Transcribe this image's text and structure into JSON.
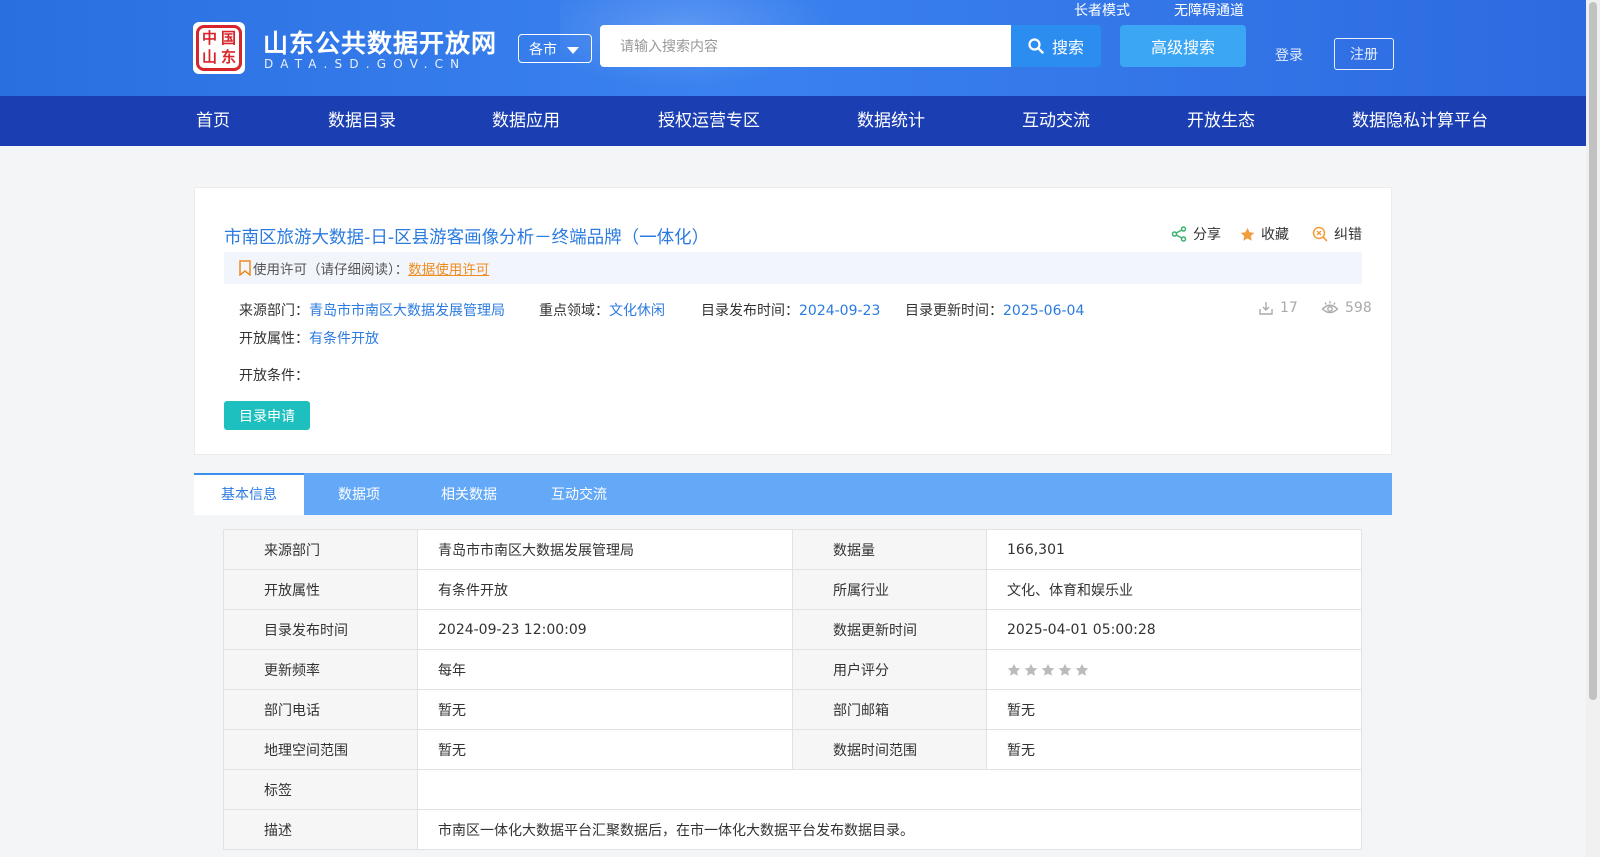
{
  "header": {
    "site_title": "山东公共数据开放网",
    "site_subtitle": "DATA.SD.GOV.CN",
    "logo_chars": [
      "中",
      "国",
      "山",
      "东"
    ],
    "city_select": "各市",
    "search_placeholder": "请输入搜索内容",
    "search_label": "搜索",
    "advanced_search_label": "高级搜索",
    "elder_mode": "长者模式",
    "accessibility": "无障碍通道",
    "login": "登录",
    "register": "注册"
  },
  "nav": {
    "items": [
      "首页",
      "数据目录",
      "数据应用",
      "授权运营专区",
      "数据统计",
      "互动交流",
      "开放生态",
      "数据隐私计算平台"
    ]
  },
  "detail": {
    "title": "市南区旅游大数据-日-区县游客画像分析－终端品牌（一体化）",
    "actions": {
      "share": "分享",
      "favorite": "收藏",
      "report": "纠错"
    },
    "license_prefix": "使用许可（请仔细阅读）：",
    "license_link": "数据使用许可",
    "source_label": "来源部门：",
    "source_value": "青岛市市南区大数据发展管理局",
    "domain_label": "重点领域：",
    "domain_value": "文化休闲",
    "publish_label": "目录发布时间：",
    "publish_value": "2024-09-23",
    "update_label": "目录更新时间：",
    "update_value": "2025-06-04",
    "downloads": "17",
    "views": "598",
    "open_attr_label": "开放属性：",
    "open_attr_value": "有条件开放",
    "open_cond_label": "开放条件：",
    "apply_button": "目录申请"
  },
  "tabs": [
    "基本信息",
    "数据项",
    "相关数据",
    "互动交流"
  ],
  "info": {
    "rows": [
      {
        "k1": "来源部门",
        "v1": "青岛市市南区大数据发展管理局",
        "k2": "数据量",
        "v2": "166,301"
      },
      {
        "k1": "开放属性",
        "v1": "有条件开放",
        "k2": "所属行业",
        "v2": "文化、体育和娱乐业"
      },
      {
        "k1": "目录发布时间",
        "v1": "2024-09-23 12:00:09",
        "k2": "数据更新时间",
        "v2": "2025-04-01 05:00:28"
      },
      {
        "k1": "更新频率",
        "v1": "每年",
        "k2": "用户评分",
        "v2": ""
      },
      {
        "k1": "部门电话",
        "v1": "暂无",
        "k2": "部门邮箱",
        "v2": "暂无"
      },
      {
        "k1": "地理空间范围",
        "v1": "暂无",
        "k2": "数据时间范围",
        "v2": "暂无"
      }
    ],
    "tags_label": "标签",
    "tags_value": "",
    "desc_label": "描述",
    "desc_value": "市南区一体化大数据平台汇聚数据后，在市一体化大数据平台发布数据目录。",
    "user_rating": 0,
    "rating_max": 5
  },
  "colors": {
    "header": "#2a6fe0",
    "nav": "#1b3fb3",
    "link": "#2b7be0",
    "license": "#f08c1e",
    "apply": "#1dbfbf",
    "tabs": "#64a8f8"
  }
}
